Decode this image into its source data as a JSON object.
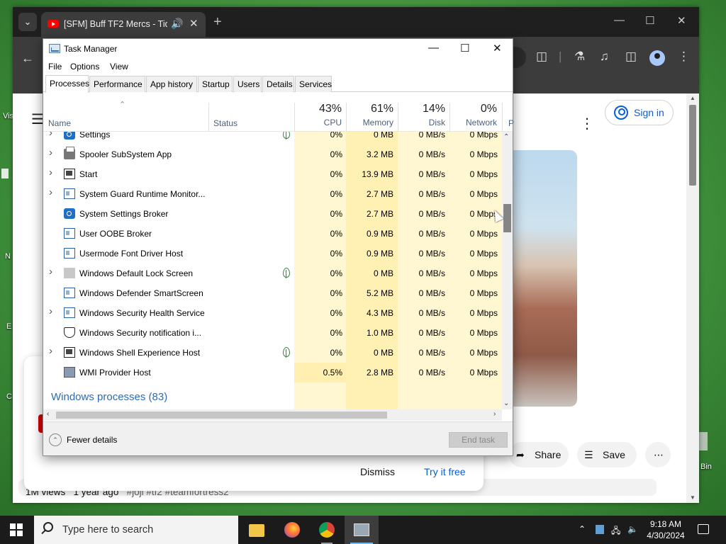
{
  "browser": {
    "tab_title": "[SFM] Buff TF2 Mercs - Tid",
    "tab_close": "✕",
    "new_tab": "+",
    "tab_menu": "⌄",
    "window_controls": {
      "minimize": "—",
      "maximize": "☐",
      "close": "✕"
    },
    "back": "←"
  },
  "youtube": {
    "sign_in": "Sign in",
    "share": "Share",
    "save": "Save",
    "more": "⋮",
    "views": "1M views",
    "age": "1 year ago",
    "hashtags": "#joji #tf2 #teamfortress2"
  },
  "promo": {
    "dismiss": "Dismiss",
    "try_free": "Try it free"
  },
  "task_manager": {
    "title": "Task Manager",
    "menu": [
      "File",
      "Options",
      "View"
    ],
    "tabs": [
      "Processes",
      "Performance",
      "App history",
      "Startup",
      "Users",
      "Details",
      "Services"
    ],
    "active_tab": "Processes",
    "columns": {
      "name": "Name",
      "status": "Status",
      "cpu": {
        "pct": "43%",
        "label": "CPU"
      },
      "memory": {
        "pct": "61%",
        "label": "Memory"
      },
      "disk": {
        "pct": "14%",
        "label": "Disk"
      },
      "network": {
        "pct": "0%",
        "label": "Network"
      },
      "power_cut": "P"
    },
    "rows": [
      {
        "name": "Settings",
        "icon": "gear-icon",
        "expand": true,
        "leaf": true,
        "cpu": "0%",
        "mem": "0 MB",
        "disk": "0 MB/s",
        "net": "0 Mbps"
      },
      {
        "name": "Spooler SubSystem App",
        "icon": "printer-icon",
        "expand": true,
        "leaf": false,
        "cpu": "0%",
        "mem": "3.2 MB",
        "disk": "0 MB/s",
        "net": "0 Mbps"
      },
      {
        "name": "Start",
        "icon": "window-icon",
        "expand": true,
        "leaf": false,
        "cpu": "0%",
        "mem": "13.9 MB",
        "disk": "0 MB/s",
        "net": "0 Mbps"
      },
      {
        "name": "System Guard Runtime Monitor...",
        "icon": "app-icon",
        "expand": true,
        "leaf": false,
        "cpu": "0%",
        "mem": "2.7 MB",
        "disk": "0 MB/s",
        "net": "0 Mbps"
      },
      {
        "name": "System Settings Broker",
        "icon": "gear-icon",
        "expand": false,
        "leaf": false,
        "cpu": "0%",
        "mem": "2.7 MB",
        "disk": "0 MB/s",
        "net": "0 Mbps"
      },
      {
        "name": "User OOBE Broker",
        "icon": "app-icon",
        "expand": false,
        "leaf": false,
        "cpu": "0%",
        "mem": "0.9 MB",
        "disk": "0 MB/s",
        "net": "0 Mbps"
      },
      {
        "name": "Usermode Font Driver Host",
        "icon": "app-icon",
        "expand": false,
        "leaf": false,
        "cpu": "0%",
        "mem": "0.9 MB",
        "disk": "0 MB/s",
        "net": "0 Mbps"
      },
      {
        "name": "Windows Default Lock Screen",
        "icon": "blank-icon",
        "expand": true,
        "leaf": true,
        "cpu": "0%",
        "mem": "0 MB",
        "disk": "0 MB/s",
        "net": "0 Mbps"
      },
      {
        "name": "Windows Defender SmartScreen",
        "icon": "app-icon",
        "expand": false,
        "leaf": false,
        "cpu": "0%",
        "mem": "5.2 MB",
        "disk": "0 MB/s",
        "net": "0 Mbps"
      },
      {
        "name": "Windows Security Health Service",
        "icon": "app-icon",
        "expand": true,
        "leaf": false,
        "cpu": "0%",
        "mem": "4.3 MB",
        "disk": "0 MB/s",
        "net": "0 Mbps"
      },
      {
        "name": "Windows Security notification i...",
        "icon": "shield-icon",
        "expand": false,
        "leaf": false,
        "cpu": "0%",
        "mem": "1.0 MB",
        "disk": "0 MB/s",
        "net": "0 Mbps"
      },
      {
        "name": "Windows Shell Experience Host",
        "icon": "window-icon",
        "expand": true,
        "leaf": true,
        "cpu": "0%",
        "mem": "0 MB",
        "disk": "0 MB/s",
        "net": "0 Mbps"
      },
      {
        "name": "WMI Provider Host",
        "icon": "wmi-icon",
        "expand": false,
        "leaf": false,
        "cpu": "0.5%",
        "mem": "2.8 MB",
        "disk": "0 MB/s",
        "net": "0 Mbps"
      }
    ],
    "group_label": "Windows processes (83)",
    "fewer_details": "Fewer details",
    "end_task": "End task"
  },
  "taskbar": {
    "search_placeholder": "Type here to search",
    "time": "9:18 AM",
    "date": "4/30/2024",
    "apps": [
      "file-explorer",
      "firefox",
      "chrome",
      "task-manager"
    ],
    "active_app": "task-manager"
  },
  "desktop": {
    "right_label": "Bin",
    "left_labels": [
      "Vis",
      "N",
      "E",
      "C"
    ]
  },
  "colors": {
    "cpu_shade": "#fff7d1",
    "memory_shade": "#fff0b4",
    "disk_shade": "#fff7d1",
    "network_shade": "#fff7d1",
    "wmi_cpu_shade": "#ffefb0",
    "accent_blue": "#065fd4"
  }
}
